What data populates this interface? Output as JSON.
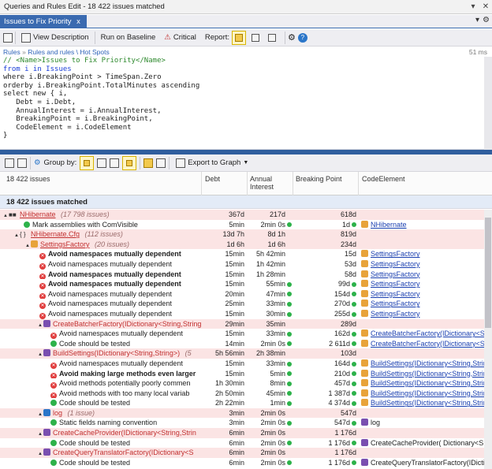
{
  "window": {
    "title": "Queries and Rules Edit - 18 422 issues matched",
    "pin": "▾",
    "close": "✕"
  },
  "tab": {
    "label": "Issues to Fix Priority",
    "close": "x",
    "more": "▾",
    "gear": "⚙"
  },
  "toolbar": {
    "view_description": "View Description",
    "run_on_baseline": "Run on Baseline",
    "critical": "Critical",
    "report": "Report:"
  },
  "breadcrumb": {
    "root": "Rules",
    "sep1": "»",
    "path": "Rules and rules \\ Hot Spots",
    "time": "51 ms"
  },
  "editor": {
    "lines": [
      "// <Name>Issues to Fix Priority</Name>",
      "from i in Issues",
      "where i.BreakingPoint > TimeSpan.Zero",
      "orderby i.BreakingPoint.TotalMinutes ascending",
      "select new { i,",
      "   Debt = i.Debt,",
      "   AnnualInterest = i.AnnualInterest,",
      "   BreakingPoint = i.BreakingPoint,",
      "   CodeElement = i.CodeElement",
      "}"
    ]
  },
  "toolbar2": {
    "group_by": "Group by:",
    "export": "Export to Graph"
  },
  "columns": {
    "issues": "18 422 issues",
    "debt": "Debt",
    "annual_interest": "Annual Interest",
    "breaking_point": "Breaking Point",
    "code_element": "CodeElement"
  },
  "matched": "18 422 issues matched",
  "rows": [
    {
      "indent": 4,
      "kind": "assembly",
      "exp": "▲",
      "name": "NHibernate",
      "count": "(17 798 issues)",
      "debt": "367d",
      "interest": "217d",
      "bp": "618d",
      "ce": "",
      "pink": true,
      "gdot": false
    },
    {
      "indent": 30,
      "kind": "rule-ok",
      "exp": "",
      "name": "Mark assemblies with ComVisible",
      "count": "",
      "debt": "5min",
      "interest": "2min 0s",
      "bp": "1d",
      "ce": "NHibernate",
      "pink": false,
      "gdot": true,
      "link": true
    },
    {
      "indent": 18,
      "kind": "namespace",
      "exp": "▲",
      "name": "NHibernate.Cfg",
      "count": "(112 issues)",
      "debt": "13d 7h",
      "interest": "8d 1h",
      "bp": "819d",
      "ce": "",
      "pink": true,
      "gdot": false
    },
    {
      "indent": 32,
      "kind": "class",
      "exp": "▲",
      "name": "SettingsFactory",
      "count": "(20 issues)",
      "debt": "1d 6h",
      "interest": "1d 6h",
      "bp": "234d",
      "ce": "",
      "pink": true,
      "gdot": false
    },
    {
      "indent": 50,
      "kind": "rule-bad",
      "exp": "",
      "name": "Avoid namespaces mutually dependent",
      "count": "",
      "debt": "15min",
      "interest": "5h 42min",
      "bp": "15d",
      "ce": "SettingsFactory",
      "pink": false,
      "gdot": false,
      "bold": true,
      "link": true
    },
    {
      "indent": 50,
      "kind": "rule-bad",
      "exp": "",
      "name": "Avoid namespaces mutually dependent",
      "count": "",
      "debt": "15min",
      "interest": "1h 42min",
      "bp": "53d",
      "ce": "SettingsFactory",
      "pink": false,
      "gdot": false,
      "link": true
    },
    {
      "indent": 50,
      "kind": "rule-bad",
      "exp": "",
      "name": "Avoid namespaces mutually dependent",
      "count": "",
      "debt": "15min",
      "interest": "1h 28min",
      "bp": "58d",
      "ce": "SettingsFactory",
      "pink": false,
      "gdot": false,
      "bold": true,
      "link": true
    },
    {
      "indent": 50,
      "kind": "rule-bad",
      "exp": "",
      "name": "Avoid namespaces mutually dependent",
      "count": "",
      "debt": "15min",
      "interest": "55min",
      "bp": "99d",
      "ce": "SettingsFactory",
      "pink": false,
      "gdot": true,
      "bold": true,
      "link": true
    },
    {
      "indent": 50,
      "kind": "rule-bad",
      "exp": "",
      "name": "Avoid namespaces mutually dependent",
      "count": "",
      "debt": "20min",
      "interest": "47min",
      "bp": "154d",
      "ce": "SettingsFactory",
      "pink": false,
      "gdot": true,
      "link": true
    },
    {
      "indent": 50,
      "kind": "rule-bad",
      "exp": "",
      "name": "Avoid namespaces mutually dependent",
      "count": "",
      "debt": "25min",
      "interest": "33min",
      "bp": "270d",
      "ce": "SettingsFactory",
      "pink": false,
      "gdot": true,
      "link": true
    },
    {
      "indent": 50,
      "kind": "rule-bad",
      "exp": "",
      "name": "Avoid namespaces mutually dependent",
      "count": "",
      "debt": "15min",
      "interest": "30min",
      "bp": "255d",
      "ce": "SettingsFactory",
      "pink": false,
      "gdot": true,
      "link": true
    },
    {
      "indent": 48,
      "kind": "method",
      "exp": "▲",
      "name": "CreateBatcherFactory(IDictionary<String,String>",
      "count": "",
      "debt": "29min",
      "interest": "35min",
      "bp": "289d",
      "ce": "",
      "pink": true,
      "gdot": false
    },
    {
      "indent": 64,
      "kind": "rule-bad",
      "exp": "",
      "name": "Avoid namespaces mutually dependent",
      "count": "",
      "debt": "15min",
      "interest": "33min",
      "bp": "162d",
      "ce": "CreateBatcherFactory(IDictionary<S",
      "pink": false,
      "gdot": true,
      "link": true
    },
    {
      "indent": 64,
      "kind": "rule-ok",
      "exp": "",
      "name": "Code should be tested",
      "count": "",
      "debt": "14min",
      "interest": "2min 0s",
      "bp": "2 611d",
      "ce": "CreateBatcherFactory(IDictionary<St",
      "pink": false,
      "gdot": true,
      "link": true
    },
    {
      "indent": 48,
      "kind": "method",
      "exp": "▲",
      "name": "BuildSettings(IDictionary<String,String>)",
      "count": "(5",
      "debt": "5h 56min",
      "interest": "2h 38min",
      "bp": "103d",
      "ce": "",
      "pink": true,
      "gdot": false
    },
    {
      "indent": 64,
      "kind": "rule-bad",
      "exp": "",
      "name": "Avoid namespaces mutually dependent",
      "count": "",
      "debt": "15min",
      "interest": "33min",
      "bp": "164d",
      "ce": "BuildSettings(IDictionary<String,Strin",
      "pink": false,
      "gdot": true,
      "link": true
    },
    {
      "indent": 64,
      "kind": "rule-bad",
      "exp": "",
      "name": "Avoid making large methods even larger",
      "count": "",
      "debt": "15min",
      "interest": "5min",
      "bp": "210d",
      "ce": "BuildSettings(IDictionary<String,Strin",
      "pink": false,
      "gdot": true,
      "bold": true,
      "link": true
    },
    {
      "indent": 64,
      "kind": "rule-bad",
      "exp": "",
      "name": "Avoid methods potentially poorly commen",
      "count": "",
      "debt": "1h 30min",
      "interest": "8min",
      "bp": "457d",
      "ce": "BuildSettings(IDictionary<String,Strin",
      "pink": false,
      "gdot": true,
      "link": true
    },
    {
      "indent": 64,
      "kind": "rule-bad",
      "exp": "",
      "name": "Avoid methods with too many local variab",
      "count": "",
      "debt": "2h 50min",
      "interest": "45min",
      "bp": "1 387d",
      "ce": "BuildSettings(IDictionary<String,Strin",
      "pink": false,
      "gdot": true,
      "link": true
    },
    {
      "indent": 64,
      "kind": "rule-ok",
      "exp": "",
      "name": "Code should be tested",
      "count": "",
      "debt": "2h 22min",
      "interest": "1min",
      "bp": "4 374d",
      "ce": "BuildSettings(IDictionary<String,Strin",
      "pink": false,
      "gdot": true,
      "link": true
    },
    {
      "indent": 48,
      "kind": "field",
      "exp": "▲",
      "name": "log",
      "count": "(1 issue)",
      "debt": "3min",
      "interest": "2min 0s",
      "bp": "547d",
      "ce": "",
      "pink": true,
      "gdot": false
    },
    {
      "indent": 64,
      "kind": "rule-ok",
      "exp": "",
      "name": "Static fields naming convention",
      "count": "",
      "debt": "3min",
      "interest": "2min 0s",
      "bp": "547d",
      "ce": "log",
      "pink": false,
      "gdot": true,
      "link": false
    },
    {
      "indent": 48,
      "kind": "method",
      "exp": "▲",
      "name": "CreateCacheProvider(IDictionary<String,Strin",
      "count": "",
      "debt": "6min",
      "interest": "2min 0s",
      "bp": "1 176d",
      "ce": "",
      "pink": true,
      "gdot": false
    },
    {
      "indent": 64,
      "kind": "rule-ok",
      "exp": "",
      "name": "Code should be tested",
      "count": "",
      "debt": "6min",
      "interest": "2min 0s",
      "bp": "1 176d",
      "ce": "CreateCacheProvider( Dictionary<S",
      "pink": false,
      "gdot": true,
      "link": false
    },
    {
      "indent": 48,
      "kind": "method",
      "exp": "▲",
      "name": "CreateQueryTranslatorFactory(IDictionary<S",
      "count": "",
      "debt": "6min",
      "interest": "2min 0s",
      "bp": "1 176d",
      "ce": "",
      "pink": true,
      "gdot": false
    },
    {
      "indent": 64,
      "kind": "rule-ok",
      "exp": "",
      "name": "Code should be tested",
      "count": "",
      "debt": "6min",
      "interest": "2min 0s",
      "bp": "1 176d",
      "ce": "CreateQueryTranslatorFactory(IDicti",
      "pink": false,
      "gdot": true,
      "link": false
    }
  ]
}
